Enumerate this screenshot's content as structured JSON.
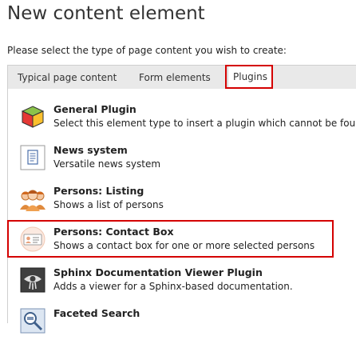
{
  "page": {
    "title": "New content element",
    "intro": "Please select the type of page content you wish to create:"
  },
  "tabs": [
    {
      "label": "Typical page content",
      "active": false
    },
    {
      "label": "Form elements",
      "active": false
    },
    {
      "label": "Plugins",
      "active": true
    }
  ],
  "items": [
    {
      "name": "General Plugin",
      "description": "Select this element type to insert a plugin which cannot be fou",
      "icon": "cube-plugin-icon"
    },
    {
      "name": "News system",
      "description": "Versatile news system",
      "icon": "news-document-icon"
    },
    {
      "name": "Persons: Listing",
      "description": "Shows a list of persons",
      "icon": "persons-group-icon"
    },
    {
      "name": "Persons: Contact Box",
      "description": "Shows a contact box for one or more selected persons",
      "icon": "contact-card-icon",
      "highlighted": true
    },
    {
      "name": "Sphinx Documentation Viewer Plugin",
      "description": "Adds a viewer for a Sphinx-based documentation.",
      "icon": "sphinx-eye-icon"
    },
    {
      "name": "Faceted Search",
      "description": "",
      "icon": "faceted-search-icon"
    }
  ],
  "colors": {
    "highlight": "#d40000",
    "tabbar_bg": "#e9e9e9",
    "border": "#cfcfcf"
  }
}
